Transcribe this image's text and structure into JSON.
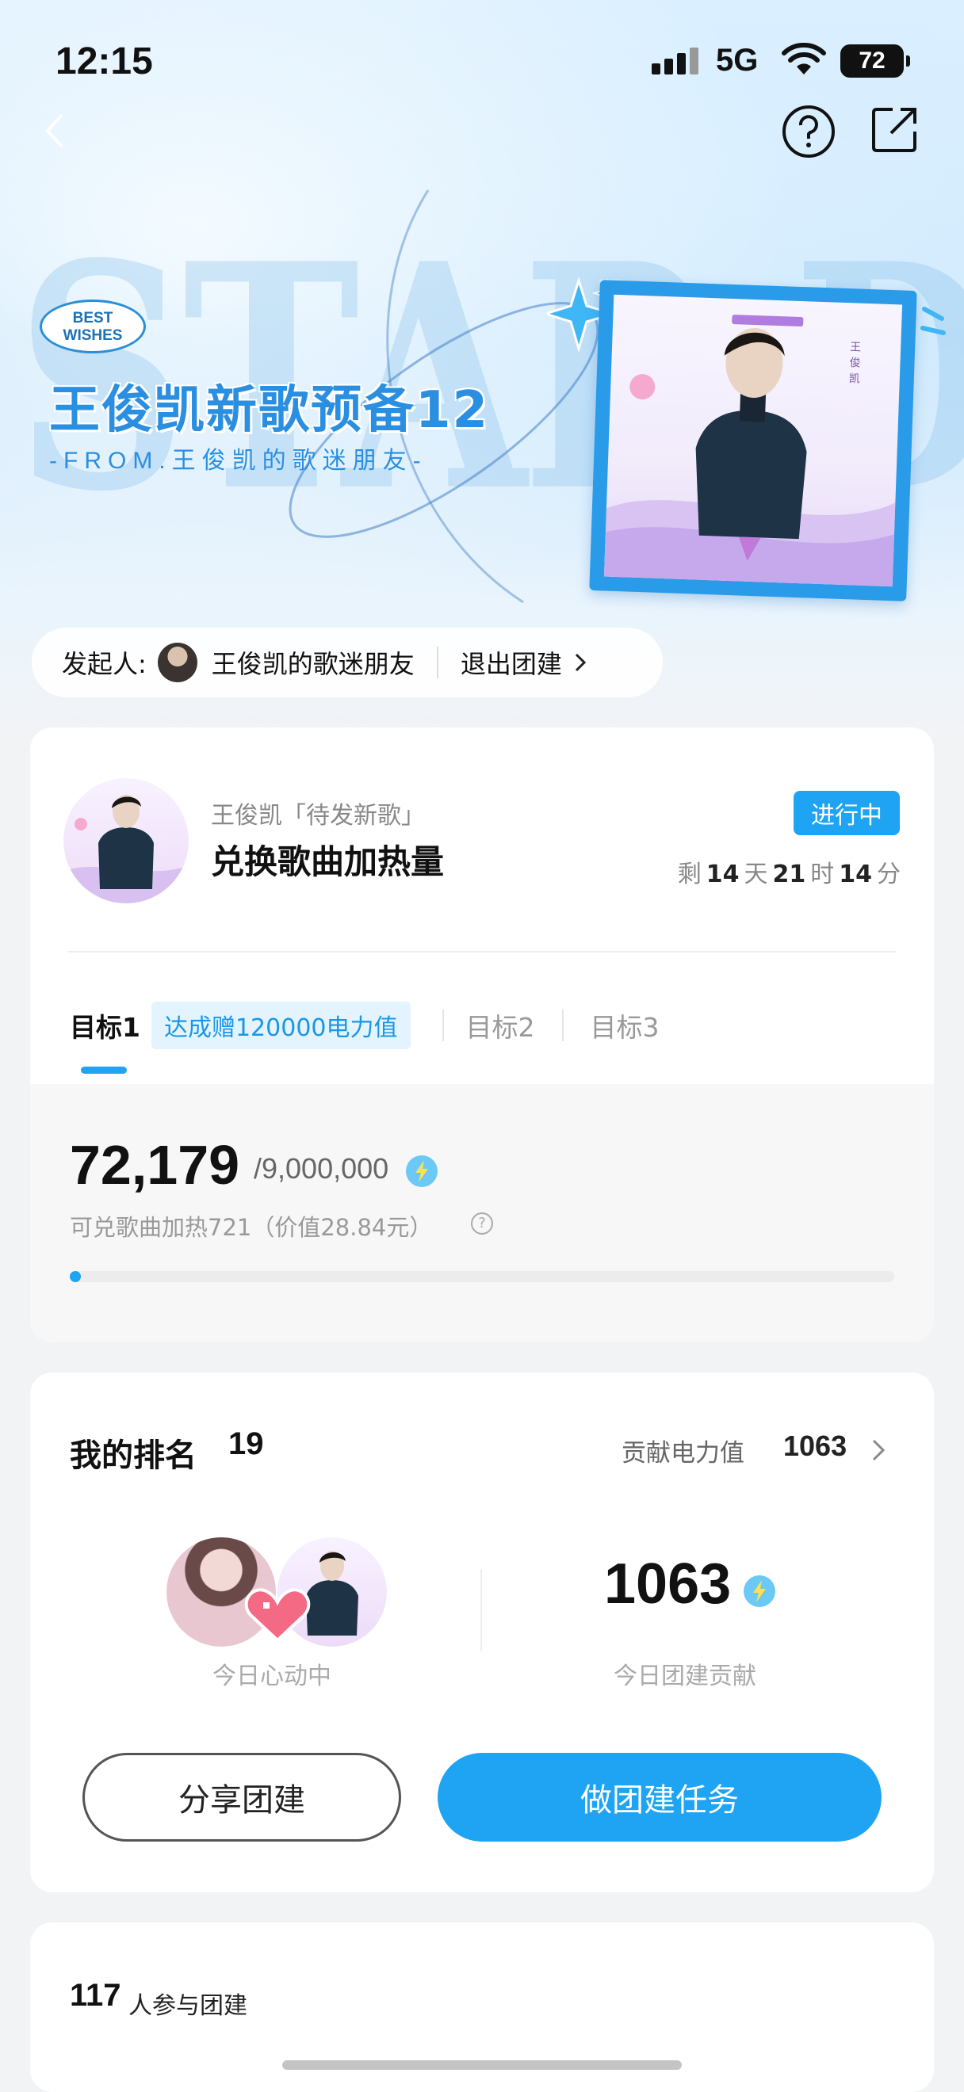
{
  "status_bar": {
    "time": "12:15",
    "network": "5G",
    "battery": "72"
  },
  "hero": {
    "badge_line1": "BEST",
    "badge_line2": "WISHES",
    "title": "王俊凯新歌预备12",
    "subtitle": "-FROM.王俊凯的歌迷朋友-",
    "bg_text": "STAR DI"
  },
  "initiator": {
    "label": "发起人:",
    "name": "王俊凯的歌迷朋友",
    "exit_label": "退出团建"
  },
  "task": {
    "subtitle": "王俊凯「待发新歌」",
    "title": "兑换歌曲加热量",
    "status": "进行中",
    "countdown": {
      "prefix": "剩",
      "days": "14",
      "days_unit": "天",
      "hours": "21",
      "hours_unit": "时",
      "minutes": "14",
      "minutes_unit": "分"
    },
    "tabs": [
      {
        "label": "目标1",
        "reward": "达成赠120000电力值"
      },
      {
        "label": "目标2"
      },
      {
        "label": "目标3"
      }
    ],
    "progress": {
      "current": "72,179",
      "total": "/9,000,000",
      "note": "可兑歌曲加热721（价值28.84元）",
      "help": "?",
      "fraction": 0.008
    }
  },
  "ranking": {
    "title": "我的排名",
    "rank": "19",
    "contribution_label": "贡献电力值",
    "contribution_value": "1063",
    "heart_label": "今日心动中",
    "today_value": "1063",
    "today_label": "今日团建贡献",
    "share_button": "分享团建",
    "task_button": "做团建任务"
  },
  "participants": {
    "count": "117",
    "label": "人参与团建"
  },
  "colors": {
    "accent": "#1ea4f2",
    "hero_title": "#2a8fe0"
  },
  "icons": [
    "back-icon",
    "help-icon",
    "share-icon",
    "bolt-icon",
    "heart-icon",
    "chevron-right-icon"
  ]
}
